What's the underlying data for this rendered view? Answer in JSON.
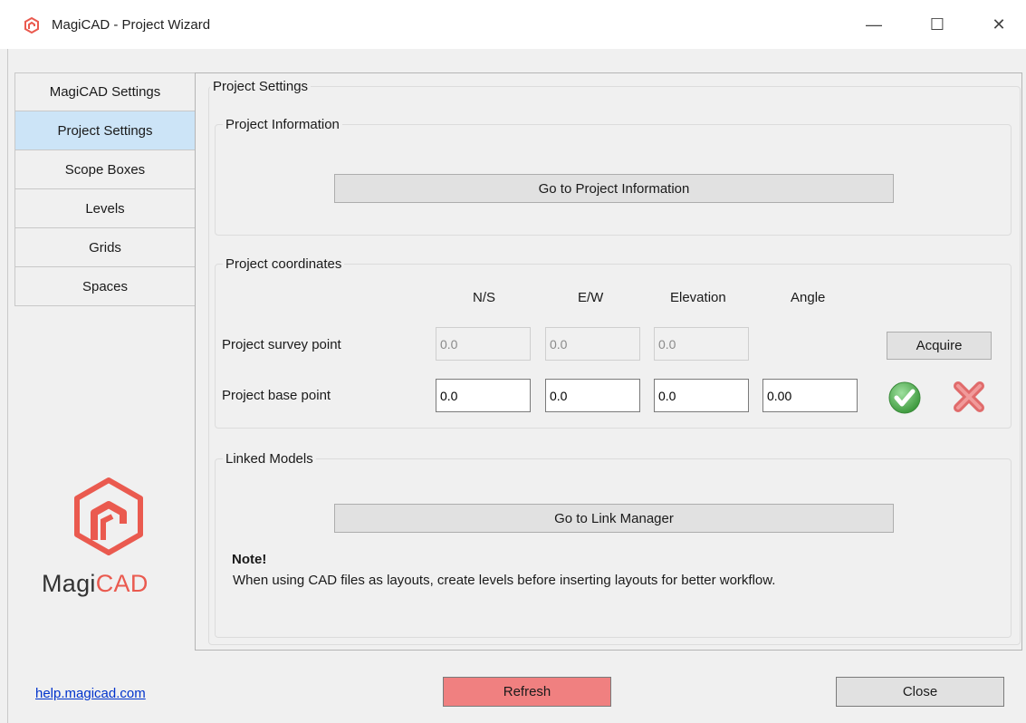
{
  "window": {
    "title": "MagiCAD - Project Wizard",
    "minimize_glyph": "—",
    "maximize_glyph": "☐",
    "close_glyph": "✕"
  },
  "sidebar": {
    "items": [
      {
        "label": "MagiCAD Settings"
      },
      {
        "label": "Project Settings"
      },
      {
        "label": "Scope Boxes"
      },
      {
        "label": "Levels"
      },
      {
        "label": "Grids"
      },
      {
        "label": "Spaces"
      }
    ],
    "active_index": 1
  },
  "logo": {
    "text_part1": "Magi",
    "text_part2": "CAD",
    "accent_color": "#ea5a4f"
  },
  "main": {
    "group_title": "Project Settings",
    "project_information": {
      "title": "Project Information",
      "button_label": "Go to Project Information"
    },
    "project_coordinates": {
      "title": "Project coordinates",
      "columns": [
        "N/S",
        "E/W",
        "Elevation",
        "Angle"
      ],
      "survey_point": {
        "label": "Project survey point",
        "ns": "0.0",
        "ew": "0.0",
        "elevation": "0.0"
      },
      "base_point": {
        "label": "Project base point",
        "ns": "0.0",
        "ew": "0.0",
        "elevation": "0.0",
        "angle": "0.00"
      },
      "acquire_label": "Acquire",
      "ok_icon": "check-circle-icon",
      "cancel_icon": "cross-icon"
    },
    "linked_models": {
      "title": "Linked Models",
      "button_label": "Go to Link Manager",
      "note_title": "Note!",
      "note_text": "When using CAD files as layouts, create levels before inserting layouts for better workflow."
    }
  },
  "footer": {
    "help_link": "help.magicad.com",
    "refresh_label": "Refresh",
    "close_label": "Close",
    "refresh_color": "#f08080"
  }
}
